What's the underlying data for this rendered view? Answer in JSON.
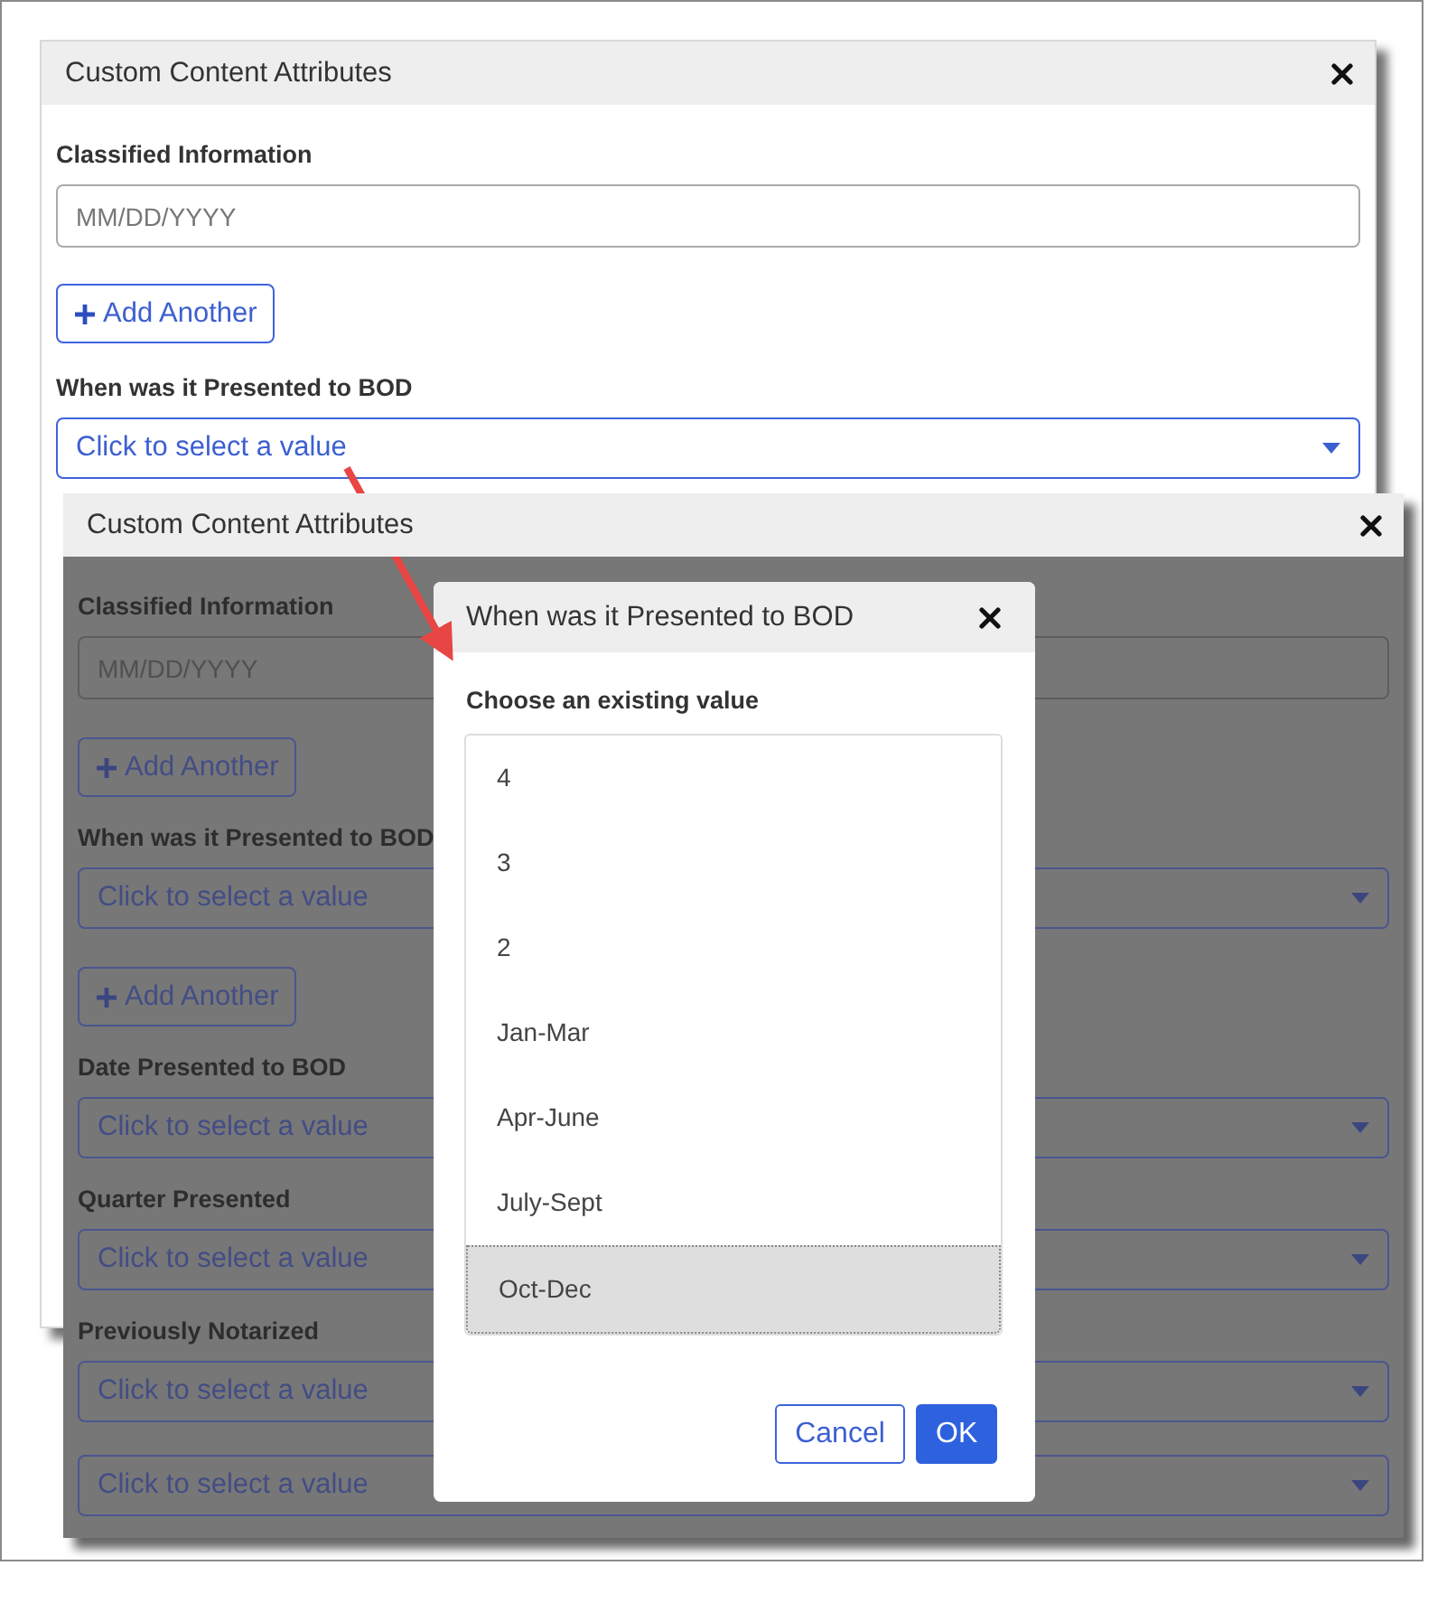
{
  "background_dialog": {
    "title": "Custom Content Attributes",
    "fields": [
      {
        "kind": "date",
        "label": "Classified Information",
        "placeholder": "MM/DD/YYYY"
      },
      {
        "kind": "add",
        "text": "Add Another"
      },
      {
        "kind": "select",
        "label": "When was it Presented to BOD",
        "placeholder": "Click to select a value"
      }
    ]
  },
  "overlay_dialog": {
    "title": "Custom Content Attributes",
    "fields": [
      {
        "kind": "date",
        "label": "Classified Information",
        "placeholder": "MM/DD/YYYY"
      },
      {
        "kind": "add",
        "text": "Add Another"
      },
      {
        "kind": "select",
        "label": "When was it Presented to BOD",
        "placeholder": "Click to select a value"
      },
      {
        "kind": "add",
        "text": "Add Another"
      },
      {
        "kind": "select",
        "label": "Date Presented to BOD",
        "placeholder": "Click to select a value"
      },
      {
        "kind": "select",
        "label": "Quarter Presented",
        "placeholder": "Click to select a value"
      },
      {
        "kind": "select",
        "label": "Previously Notarized",
        "placeholder": "Click to select a value"
      },
      {
        "kind": "select",
        "placeholder": "Click to select a value"
      }
    ]
  },
  "value_picker": {
    "title": "When was it Presented to BOD",
    "prompt": "Choose an existing value",
    "options": [
      {
        "label": "4",
        "selected": false
      },
      {
        "label": "3",
        "selected": false
      },
      {
        "label": "2",
        "selected": false
      },
      {
        "label": "Jan-Mar",
        "selected": false
      },
      {
        "label": "Apr-June",
        "selected": false
      },
      {
        "label": "July-Sept",
        "selected": false
      },
      {
        "label": "Oct-Dec",
        "selected": true
      }
    ],
    "buttons": [
      {
        "kind": "secondary",
        "label": "Cancel"
      },
      {
        "kind": "primary",
        "label": "OK"
      }
    ]
  }
}
